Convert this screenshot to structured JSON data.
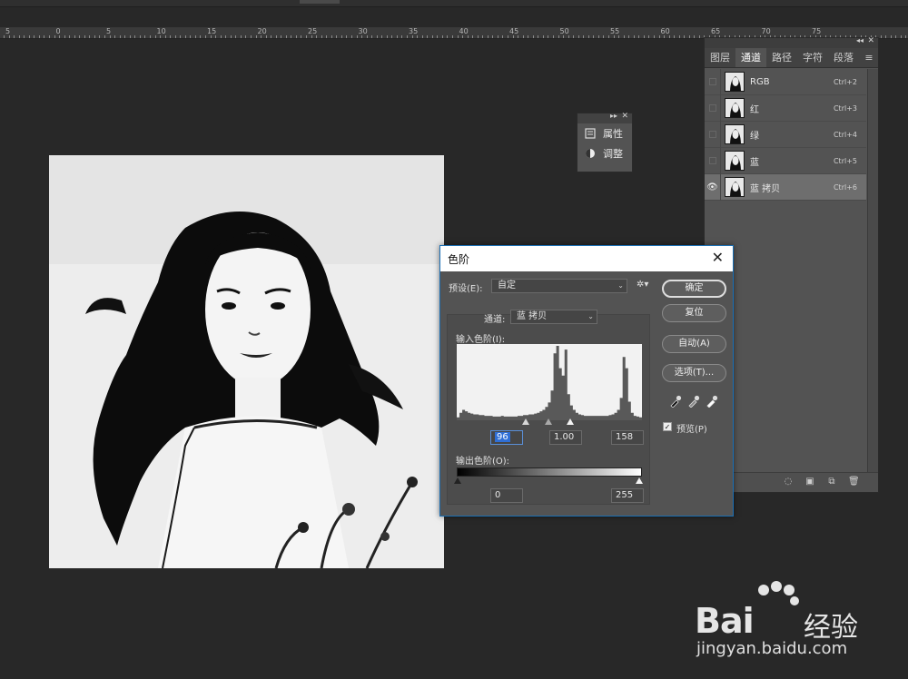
{
  "ruler": {
    "labels": [
      "5",
      "0",
      "5",
      "10",
      "15",
      "20",
      "25",
      "30",
      "35",
      "40",
      "45",
      "50",
      "55",
      "60",
      "65",
      "70",
      "75"
    ]
  },
  "properties_panel": {
    "items": [
      {
        "label": "属性",
        "icon": "properties-icon"
      },
      {
        "label": "调整",
        "icon": "adjustments-icon"
      }
    ]
  },
  "channels_panel": {
    "tabs": [
      "图层",
      "通道",
      "路径",
      "字符",
      "段落"
    ],
    "active_tab": "通道",
    "channels": [
      {
        "name": "RGB",
        "shortcut": "Ctrl+2",
        "visible": false
      },
      {
        "name": "红",
        "shortcut": "Ctrl+3",
        "visible": false
      },
      {
        "name": "绿",
        "shortcut": "Ctrl+4",
        "visible": false
      },
      {
        "name": "蓝",
        "shortcut": "Ctrl+5",
        "visible": false
      },
      {
        "name": "蓝 拷贝",
        "shortcut": "Ctrl+6",
        "visible": true,
        "selected": true
      }
    ]
  },
  "levels_dialog": {
    "title": "色阶",
    "preset_label": "预设(E):",
    "preset_value": "自定",
    "channel_label": "通道:",
    "channel_value": "蓝 拷贝",
    "input_levels_label": "输入色阶(I):",
    "input_black": "96",
    "input_gamma": "1.00",
    "input_white": "158",
    "output_levels_label": "输出色阶(O):",
    "output_black": "0",
    "output_white": "255",
    "buttons": {
      "ok": "确定",
      "reset": "复位",
      "auto": "自动(A)",
      "options": "选项(T)..."
    },
    "preview_label": "预览(P)",
    "preview_checked": true,
    "histogram": [
      4,
      10,
      14,
      12,
      10,
      9,
      8,
      8,
      7,
      7,
      6,
      6,
      6,
      5,
      5,
      5,
      6,
      5,
      5,
      5,
      5,
      5,
      6,
      6,
      7,
      7,
      8,
      8,
      9,
      10,
      12,
      14,
      18,
      24,
      40,
      90,
      100,
      70,
      60,
      95,
      35,
      20,
      14,
      10,
      8,
      7,
      6,
      6,
      6,
      6,
      6,
      6,
      6,
      6,
      6,
      7,
      8,
      10,
      14,
      30,
      85,
      70,
      25,
      10,
      6,
      5,
      4
    ]
  },
  "watermark": {
    "brand": "Bai",
    "brand_cn": "经验",
    "url": "jingyan.baidu.com"
  }
}
